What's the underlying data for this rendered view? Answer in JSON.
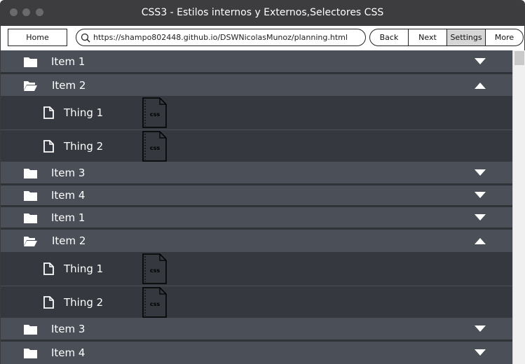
{
  "window": {
    "title": "CSS3 - Estilos internos y Externos,Selectores CSS"
  },
  "toolbar": {
    "home_label": "Home",
    "url": "https://shampo802448.github.io/DSWNicolasMunoz/planning.html",
    "back_label": "Back",
    "next_label": "Next",
    "settings_label": "Settings",
    "more_label": "More"
  },
  "menu": {
    "item1": "Item 1",
    "item2": "Item 2",
    "item3": "Item 3",
    "item4": "Item 4",
    "thing1": "Thing 1",
    "thing2": "Thing 2",
    "file_badge": "css"
  },
  "colors": {
    "item_bg": "#4a4f58",
    "thing_bg": "#35383e",
    "titlebar_bg": "#3d3d3f"
  },
  "icons": [
    "folder-icon",
    "folder-open-icon",
    "document-icon",
    "css-file-icon",
    "caret-down-icon",
    "caret-up-icon",
    "search-icon"
  ]
}
